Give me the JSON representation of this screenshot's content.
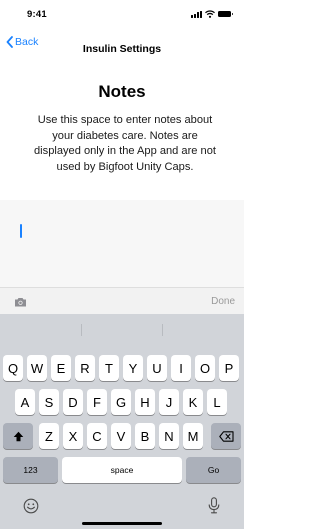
{
  "status_bar": {
    "time": "9:41"
  },
  "nav": {
    "back_label": "Back",
    "title": "Insulin Settings"
  },
  "page": {
    "title": "Notes",
    "description_lines": [
      "Use this space to enter notes about",
      "your diabetes care. Notes are",
      "displayed only in the App and are not",
      "used by Bigfoot Unity Caps."
    ]
  },
  "notes_field": {
    "value": ""
  },
  "accessory_bar": {
    "done_label": "Done",
    "camera_icon": "camera-icon"
  },
  "keyboard": {
    "row1": [
      "Q",
      "W",
      "E",
      "R",
      "T",
      "Y",
      "U",
      "I",
      "O",
      "P"
    ],
    "row2": [
      "A",
      "S",
      "D",
      "F",
      "G",
      "H",
      "J",
      "K",
      "L"
    ],
    "row3": [
      "Z",
      "X",
      "C",
      "V",
      "B",
      "N",
      "M"
    ],
    "numbers_label": "123",
    "space_label": "space",
    "go_label": "Go",
    "shift_icon": "shift-icon",
    "delete_icon": "delete-icon",
    "emoji_icon": "emoji-icon",
    "mic_icon": "microphone-icon"
  },
  "colors": {
    "accent": "#1a82ff",
    "keyboard_bg": "#d1d4d9",
    "key_bg": "#ffffff",
    "key_dark": "#abb0ba"
  }
}
